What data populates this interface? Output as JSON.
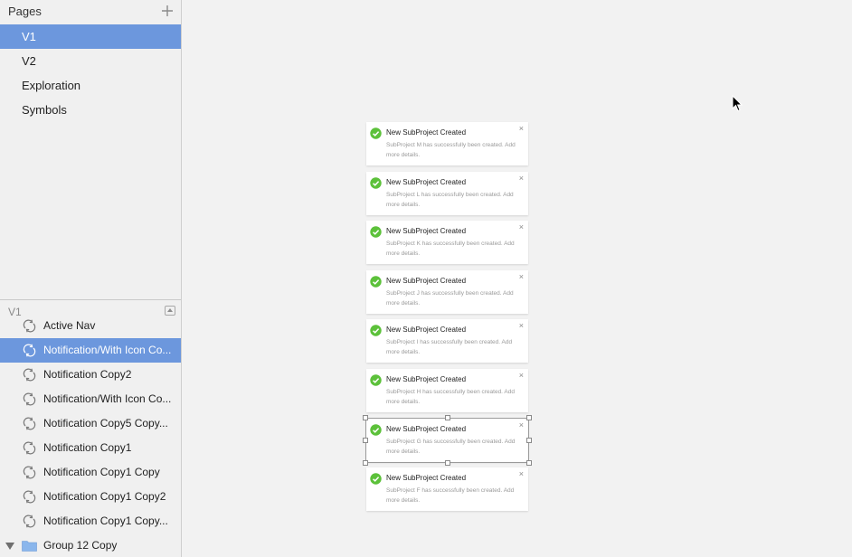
{
  "sidebar": {
    "pages_title": "Pages",
    "pages": [
      {
        "label": "V1",
        "selected": true
      },
      {
        "label": "V2",
        "selected": false
      },
      {
        "label": "Exploration",
        "selected": false
      },
      {
        "label": "Symbols",
        "selected": false
      }
    ],
    "layers_title": "V1",
    "layers": [
      {
        "label": "Active Nav",
        "icon": "symbol-icon",
        "selected": false
      },
      {
        "label": "Notification/With Icon Co...",
        "icon": "symbol-icon",
        "selected": true
      },
      {
        "label": "Notification Copy2",
        "icon": "symbol-icon",
        "selected": false
      },
      {
        "label": "Notification/With Icon Co...",
        "icon": "symbol-icon",
        "selected": false
      },
      {
        "label": "Notification Copy5 Copy...",
        "icon": "symbol-icon",
        "selected": false
      },
      {
        "label": "Notification Copy1",
        "icon": "symbol-icon",
        "selected": false
      },
      {
        "label": "Notification Copy1 Copy",
        "icon": "symbol-icon",
        "selected": false
      },
      {
        "label": "Notification Copy1 Copy2",
        "icon": "symbol-icon",
        "selected": false
      },
      {
        "label": "Notification Copy1 Copy...",
        "icon": "symbol-icon",
        "selected": false
      },
      {
        "label": "Group 12 Copy",
        "icon": "folder-icon",
        "selected": false
      }
    ]
  },
  "canvas": {
    "notifications": [
      {
        "title": "New SubProject Created",
        "body": "SubProject M has successfully been created. Add more details.",
        "close": "×"
      },
      {
        "title": "New SubProject Created",
        "body": "SubProject L has successfully been created. Add more details.",
        "close": "×"
      },
      {
        "title": "New SubProject Created",
        "body": "SubProject K has successfully been created. Add more details.",
        "close": "×"
      },
      {
        "title": "New SubProject Created",
        "body": "SubProject J has successfully been created. Add more details.",
        "close": "×"
      },
      {
        "title": "New SubProject Created",
        "body": "SubProject I has successfully been created. Add more details.",
        "close": "×"
      },
      {
        "title": "New SubProject Created",
        "body": "SubProject H has successfully been created. Add more details.",
        "close": "×"
      },
      {
        "title": "New SubProject Created",
        "body": "SubProject G has successfully been created. Add more details.",
        "close": "×"
      },
      {
        "title": "New SubProject Created",
        "body": "SubProject F has successfully been created. Add more details.",
        "close": "×"
      }
    ],
    "selected_notification_index": 6
  },
  "colors": {
    "selection": "#6c97dd",
    "success_icon": "#5cc13a",
    "folder_icon": "#8ab6ec"
  }
}
